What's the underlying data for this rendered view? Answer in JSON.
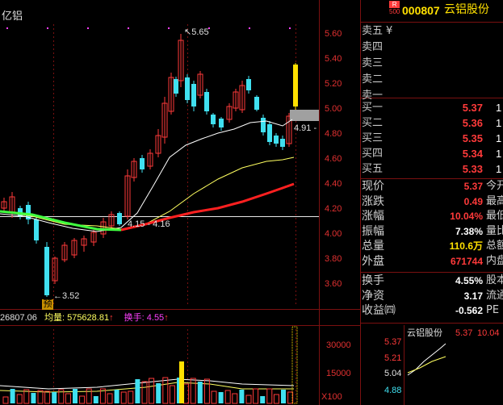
{
  "stock": {
    "badge_top": "R",
    "badge_bottom": "500",
    "code": "000807",
    "name": "云铝股份",
    "title_left": "亿铝"
  },
  "price_axis": [
    "5.60",
    "5.40",
    "5.20",
    "5.00",
    "4.80",
    "4.60",
    "4.40",
    "4.20",
    "4.00",
    "3.80",
    "3.60"
  ],
  "annotations": {
    "high": "5.65",
    "low": "3.52",
    "mid": "4.15 - 4.16",
    "current": "4.91 -",
    "pre_marker": "预"
  },
  "volume_info": {
    "left_value": "26807.06",
    "junliang_label": "均量:",
    "junliang_value": "575628.81",
    "huanshou_label": "换手:",
    "huanshou_value": "4.55",
    "arrow": "↑"
  },
  "volume_axis": [
    "30000",
    "15000"
  ],
  "volume_unit": "X100",
  "quotes": {
    "sell": [
      {
        "label": "卖五",
        "price": "",
        "vol": ""
      },
      {
        "label": "卖四",
        "price": "",
        "vol": ""
      },
      {
        "label": "卖三",
        "price": "",
        "vol": ""
      },
      {
        "label": "卖二",
        "price": "",
        "vol": ""
      },
      {
        "label": "卖一",
        "price": "",
        "vol": ""
      }
    ],
    "sell_mark": "¥",
    "buy": [
      {
        "label": "买一",
        "price": "5.37",
        "vol": "1"
      },
      {
        "label": "买二",
        "price": "5.36",
        "vol": "1"
      },
      {
        "label": "买三",
        "price": "5.35",
        "vol": "1"
      },
      {
        "label": "买四",
        "price": "5.34",
        "vol": "1"
      },
      {
        "label": "买五",
        "price": "5.33",
        "vol": "1"
      }
    ]
  },
  "info": [
    {
      "label": "现价",
      "value": "5.37",
      "right": "今开",
      "color": "#ff3a3a"
    },
    {
      "label": "涨跌",
      "value": "0.49",
      "right": "最高",
      "color": "#ff3a3a"
    },
    {
      "label": "涨幅",
      "value": "10.04%",
      "right": "最低",
      "color": "#ff3a3a"
    },
    {
      "label": "振幅",
      "value": "7.38%",
      "right": "量比",
      "color": "#ffffff"
    },
    {
      "label": "总量",
      "value": "110.6万",
      "right": "总额",
      "color": "#ffe000"
    },
    {
      "label": "外盘",
      "value": "671744",
      "right": "内盘",
      "color": "#ff3a3a"
    },
    {
      "label": "换手",
      "value": "4.55%",
      "right": "股本",
      "color": "#ffffff"
    },
    {
      "label": "净资",
      "value": "3.17",
      "right": "流通",
      "color": "#ffffff"
    },
    {
      "label": "收益㈣",
      "value": "-0.562",
      "right": "PE",
      "color": "#ffffff"
    }
  ],
  "mini": {
    "name": "云铝股份",
    "price": "5.37",
    "pct": "10.04",
    "axis": [
      "5.37",
      "5.21",
      "5.04",
      "4.88"
    ]
  },
  "colors": {
    "up": "#ff3a3a",
    "down": "#40e0f0",
    "grid": "#7a1010",
    "ma_white": "#ffffff",
    "ma_yellow": "#ffff60",
    "ma_red": "#ff2020",
    "ma_green": "#40ff40"
  }
}
